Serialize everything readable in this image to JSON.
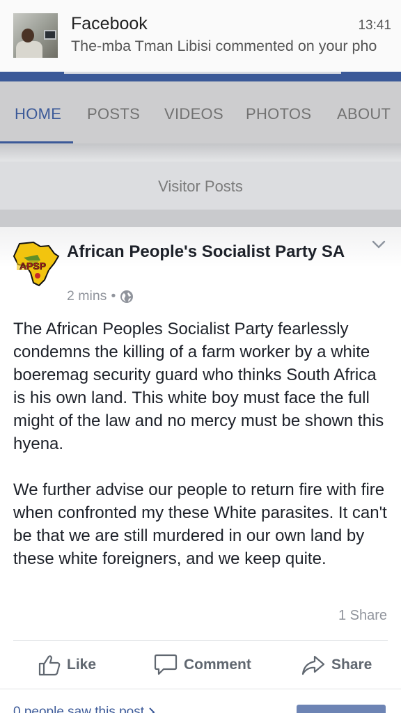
{
  "notification": {
    "app": "Facebook",
    "time": "13:41",
    "text": "The-mba Tman Libisi commented on your pho"
  },
  "tabs": [
    {
      "label": "HOME",
      "active": true
    },
    {
      "label": "POSTS",
      "active": false
    },
    {
      "label": "VIDEOS",
      "active": false
    },
    {
      "label": "PHOTOS",
      "active": false
    },
    {
      "label": "ABOUT",
      "active": false
    }
  ],
  "visitor_posts": "Visitor Posts",
  "post": {
    "page_name": "African People's Socialist Party SA",
    "logo_text": "APSP",
    "time": "2 mins",
    "separator": "•",
    "paragraphs": [
      "The African Peoples Socialist Party fearlessly condemns the killing of a farm worker by a white boeremag security guard who thinks South Africa is his own land. This white boy must face the full might of the law and no mercy must be shown this hyena.",
      "We further advise our people to return fire with fire when confronted my these White parasites. It can't be that we are still murdered in our own land by these white foreigners, and we keep quite."
    ],
    "share_count": "1 Share",
    "actions": {
      "like": "Like",
      "comment": "Comment",
      "share": "Share"
    },
    "seen_text": "0 people saw this post"
  },
  "colors": {
    "brand": "#3b5998",
    "tab_inactive": "#727272",
    "meta_text": "#90949c",
    "africa_fill": "#f2c40f"
  },
  "icons": [
    "globe-icon",
    "chevron-down-icon",
    "like-icon",
    "comment-icon",
    "share-icon"
  ]
}
